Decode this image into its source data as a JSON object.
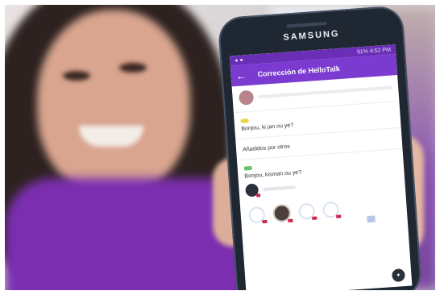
{
  "phone": {
    "brand": "SAMSUNG",
    "status_time": "4:52 PM",
    "status_info": "91%"
  },
  "app": {
    "title": "Corrección de HelloTalk",
    "sections": [
      {
        "text": "Bonjou, ki jan ou ye?"
      },
      {
        "text": "Añadidos por otros"
      },
      {
        "text": "Bonjou, kisman ou ye?"
      }
    ]
  },
  "colors": {
    "appbar": "#7b3bd1",
    "statusbar": "#6a2fb6",
    "shirt": "#7b2fb0"
  }
}
